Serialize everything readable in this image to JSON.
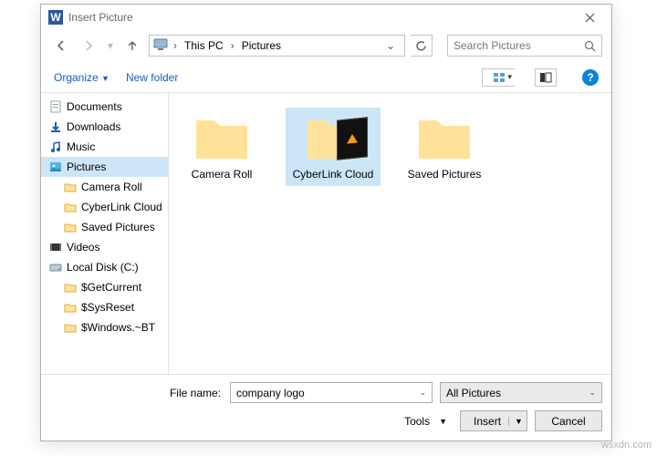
{
  "title": "Insert Picture",
  "breadcrumb": {
    "root": "This PC",
    "current": "Pictures"
  },
  "search": {
    "placeholder": "Search Pictures"
  },
  "commands": {
    "organize": "Organize",
    "newfolder": "New folder"
  },
  "tree": [
    {
      "label": "Documents",
      "icon": "doc"
    },
    {
      "label": "Downloads",
      "icon": "dl"
    },
    {
      "label": "Music",
      "icon": "music"
    },
    {
      "label": "Pictures",
      "icon": "pic",
      "selected": true
    },
    {
      "label": "Camera Roll",
      "icon": "fld",
      "level": 2
    },
    {
      "label": "CyberLink Cloud",
      "icon": "fld",
      "level": 2
    },
    {
      "label": "Saved Pictures",
      "icon": "fld",
      "level": 2
    },
    {
      "label": "Videos",
      "icon": "vid"
    },
    {
      "label": "Local Disk (C:)",
      "icon": "disk"
    },
    {
      "label": "$GetCurrent",
      "icon": "fld",
      "level": 2
    },
    {
      "label": "$SysReset",
      "icon": "fld",
      "level": 2
    },
    {
      "label": "$Windows.~BT",
      "icon": "fld",
      "level": 2
    }
  ],
  "items": [
    {
      "label": "Camera Roll",
      "kind": "folder"
    },
    {
      "label": "CyberLink Cloud",
      "kind": "folder-thumb",
      "selected": true
    },
    {
      "label": "Saved Pictures",
      "kind": "folder"
    }
  ],
  "filename": {
    "label": "File name:",
    "value": "company logo"
  },
  "filter": {
    "value": "All Pictures"
  },
  "tools": {
    "label": "Tools"
  },
  "buttons": {
    "insert": "Insert",
    "cancel": "Cancel"
  },
  "watermark": "wsxdn.com"
}
